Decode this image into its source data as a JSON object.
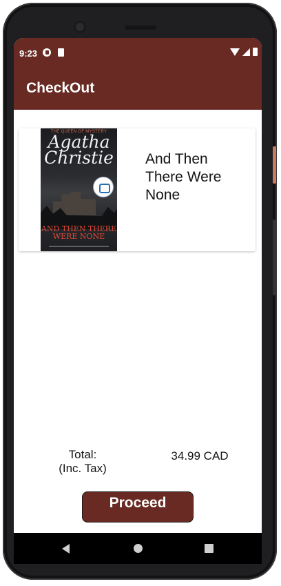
{
  "status_bar": {
    "time": "9:23",
    "icons": [
      "notification-icon",
      "sd-card-icon",
      "wifi-icon",
      "signal-icon",
      "battery-icon"
    ]
  },
  "app_bar": {
    "title": "CheckOut",
    "color": "#682a22"
  },
  "cart": {
    "items": [
      {
        "title": "And Then There Were None",
        "cover": {
          "series_text": "THE QUEEN OF MYSTERY",
          "author": "Agatha Christie",
          "title": "AND THEN THERE WERE NONE"
        }
      }
    ]
  },
  "summary": {
    "total_label": "Total:\n(Inc. Tax)",
    "total_value": "34.99 CAD"
  },
  "actions": {
    "proceed_label": "Proceed"
  },
  "nav_bar": {
    "icons": [
      "back-icon",
      "home-icon",
      "recents-icon"
    ]
  }
}
